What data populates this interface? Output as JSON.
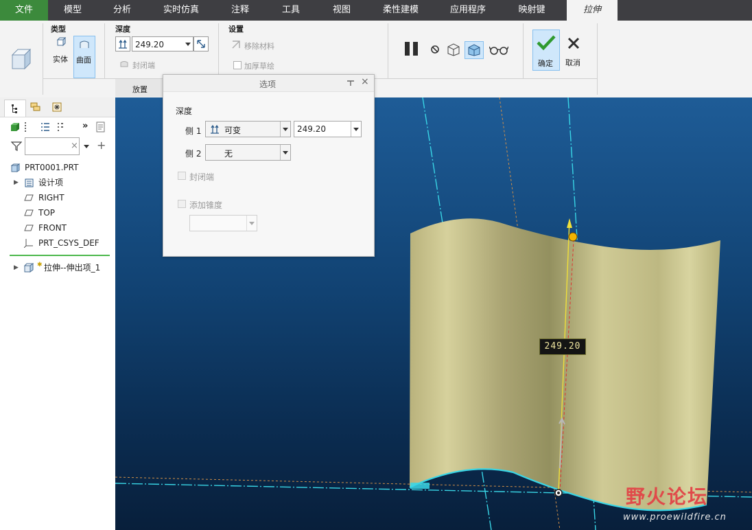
{
  "menu": {
    "tabs": [
      "文件",
      "模型",
      "分析",
      "实时仿真",
      "注释",
      "工具",
      "视图",
      "柔性建模",
      "应用程序",
      "映射键",
      "拉伸"
    ]
  },
  "ribbon": {
    "type_group_label": "类型",
    "solid_label": "实体",
    "surface_label": "曲面",
    "depth_group_label": "深度",
    "depth_value": "249.20",
    "capped_label": "封闭端",
    "settings_group_label": "设置",
    "remove_material_label": "移除材料",
    "thicken_label": "加厚草绘",
    "placement_tab": "放置",
    "ok_label": "确定",
    "cancel_label": "取消"
  },
  "options_dialog": {
    "title": "选项",
    "depth_label": "深度",
    "side1_label": "侧 1",
    "side1_type": "可变",
    "side1_value": "249.20",
    "side2_label": "侧 2",
    "side2_type": "无",
    "capped_label": "封闭端",
    "taper_label": "添加锥度"
  },
  "tree": {
    "root": "PRT0001.PRT",
    "items": [
      "设计项",
      "RIGHT",
      "TOP",
      "FRONT",
      "PRT_CSYS_DEF"
    ],
    "feature": "拉伸--伸出项_1"
  },
  "viewport": {
    "dimension_value": "249.20",
    "watermark_cn": "野火论坛",
    "watermark_url": "www.proewildfire.cn"
  },
  "colors": {
    "accent_green": "#3c8a3c",
    "surface": "#c9c48c",
    "datum": "#39d6e6"
  }
}
